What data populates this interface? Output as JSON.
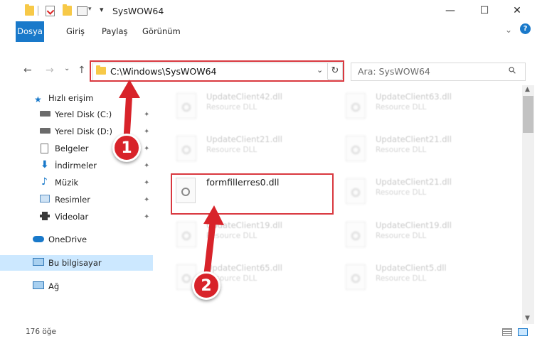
{
  "window": {
    "title": "SysWOW64",
    "controls": {
      "minimize": "—",
      "maximize": "☐",
      "close": "✕"
    }
  },
  "ribbon": {
    "tabs": [
      "Dosya",
      "Giriş",
      "Paylaş",
      "Görünüm"
    ],
    "expand_glyph": "⌄",
    "help_glyph": "?"
  },
  "nav": {
    "back": "←",
    "forward": "→",
    "recent": "⌄",
    "up": "↑",
    "address": "C:\\Windows\\SysWOW64",
    "address_dropdown": "⌄",
    "refresh": "↻",
    "search_placeholder": "Ara: SysWOW64",
    "search_glyph": "⚲"
  },
  "sidebar": {
    "quick_access": "Hızlı erişim",
    "items": [
      {
        "label": "Yerel Disk (C:)",
        "icon": "drive-icon"
      },
      {
        "label": "Yerel Disk (D:)",
        "icon": "drive-icon"
      },
      {
        "label": "Belgeler",
        "icon": "documents-icon"
      },
      {
        "label": "İndirmeler",
        "icon": "downloads-icon"
      },
      {
        "label": "Müzik",
        "icon": "music-icon"
      },
      {
        "label": "Resimler",
        "icon": "pictures-icon"
      },
      {
        "label": "Videolar",
        "icon": "videos-icon"
      }
    ],
    "onedrive": "OneDrive",
    "this_pc": "Bu bilgisayar",
    "network": "Ağ",
    "pin_glyph": "📌"
  },
  "files": {
    "featured": "formfillerres0.dll",
    "tiles": [
      {
        "name": "UpdateClient42.dll",
        "sub": "Resource DLL"
      },
      {
        "name": "UpdateClient63.dll",
        "sub": "Resource DLL"
      },
      {
        "name": "UpdateClient21.dll",
        "sub": "Resource DLL"
      },
      {
        "name": "UpdateClient21.dll",
        "sub": "Resource DLL"
      },
      {
        "name": "UpdateClient21.dll",
        "sub": "Resource DLL"
      },
      {
        "name": "UpdateClient19.dll",
        "sub": "Resource DLL"
      },
      {
        "name": "UpdateClient19.dll",
        "sub": "Resource DLL"
      },
      {
        "name": "UpdateClient65.dll",
        "sub": "Resource DLL"
      },
      {
        "name": "UpdateClient5.dll",
        "sub": "Resource DLL"
      }
    ]
  },
  "status": {
    "count": "176 öğe"
  },
  "annotations": {
    "step1": "1",
    "step2": "2",
    "color": "#d8232a"
  }
}
